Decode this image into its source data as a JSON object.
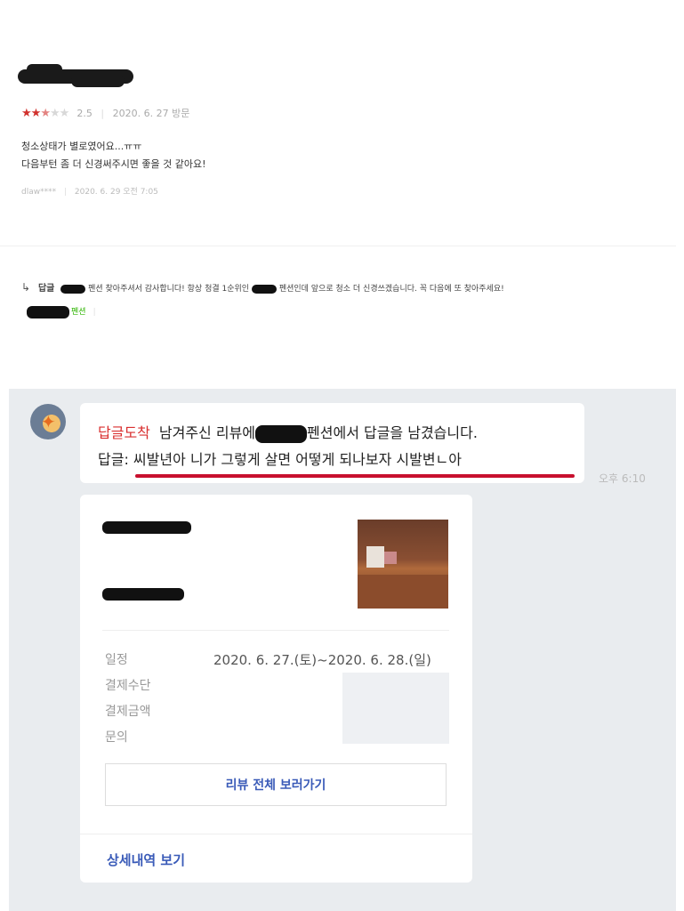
{
  "review": {
    "rating_score": "2.5",
    "rating_stars": 2.5,
    "visit_date": "2020. 6. 27 방문",
    "text_line1": "청소상태가 별로였어요...ㅠㅠ",
    "text_line2": "다음부턴 좀 더 신경써주시면 좋을 것 같아요!",
    "author_id": "dlaw****",
    "written_at": "2020. 6. 29 오전 7:05"
  },
  "owner_reply": {
    "label": "답글",
    "text_part1": "펜션 찾아주셔서 감사합니다! 항상 청결 1순위인",
    "text_part2": "펜션인데 앞으로 청소 더 신경쓰겠습니다. 꼭 다음에 또 찾아주세요!",
    "owner_suffix": "펜션"
  },
  "chat": {
    "tag": "답글도착",
    "line1_part1": "남겨주신 리뷰에",
    "line1_part2": "펜션에서 답글을 남겼습니다.",
    "line2": "답글: 씨발년아 니가 그렇게 살면 어떻게 되나보자 시발변ㄴ아",
    "time": "오후 6:10",
    "accent_color": "#c8102e"
  },
  "card": {
    "rows": [
      "일정",
      "결제수단",
      "결제금액",
      "문의"
    ],
    "schedule_value": "2020. 6. 27.(토)~2020. 6. 28.(일)",
    "full_review_button": "리뷰 전체 보러가기",
    "detail_link": "상세내역 보기"
  }
}
